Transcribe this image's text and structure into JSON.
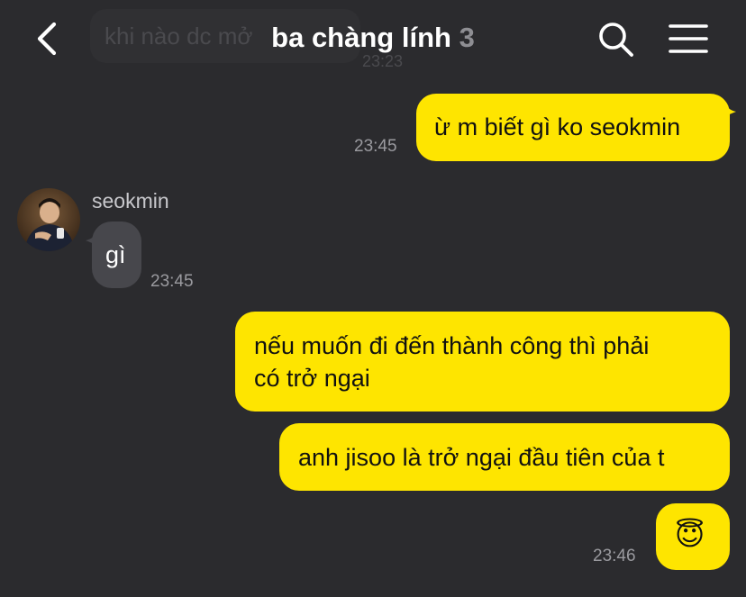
{
  "header": {
    "title": "ba chàng lính",
    "member_count": "3",
    "back_icon": "chevron-left-icon",
    "search_icon": "search-icon",
    "menu_icon": "hamburger-menu-icon"
  },
  "overlay": {
    "faded_message": "khi nào dc mở",
    "faded_time": "23:23"
  },
  "messages": [
    {
      "from": "me",
      "text": "ừ m biết gì ko seokmin",
      "time": "23:45"
    },
    {
      "from": "seokmin",
      "sender_name": "seokmin",
      "text": "gì",
      "time": "23:45"
    },
    {
      "from": "me",
      "text_line1": "nếu muốn đi đến thành công thì phải",
      "text_line2": "có trở ngại"
    },
    {
      "from": "me",
      "text": "anh jisoo là trở ngại đầu tiên của t"
    },
    {
      "from": "me",
      "text": "😇",
      "time": "23:46"
    }
  ],
  "colors": {
    "background": "#2b2b2e",
    "my_bubble": "#fee500",
    "their_bubble": "#47474c",
    "timestamp": "#9a9a9f"
  }
}
